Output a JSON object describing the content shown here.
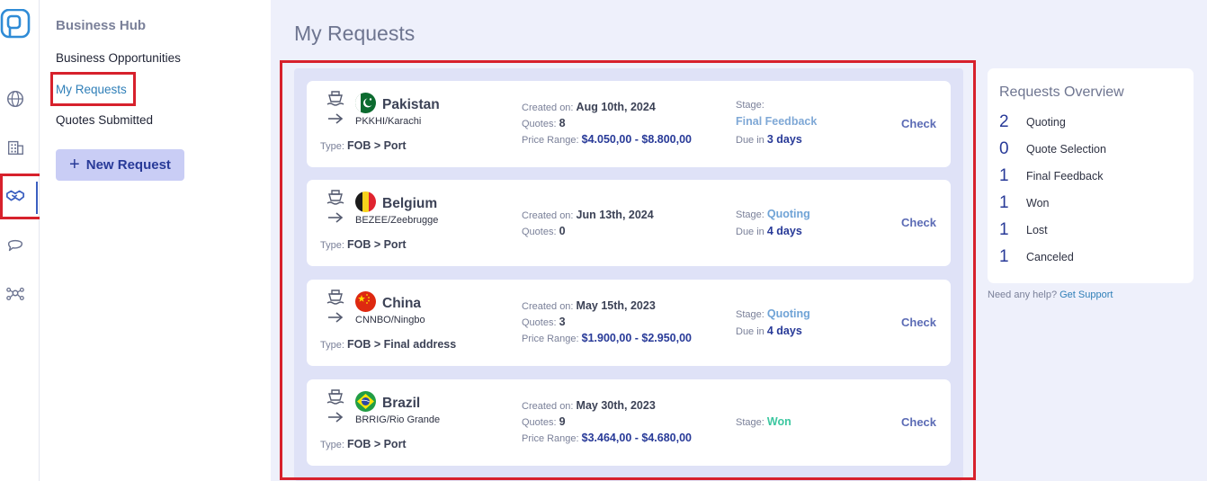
{
  "sidebar": {
    "hub_title": "Business Hub",
    "items": [
      {
        "label": "Business Opportunities"
      },
      {
        "label": "My Requests"
      },
      {
        "label": "Quotes Submitted"
      }
    ],
    "new_request_label": "New Request"
  },
  "rail": {
    "icons": [
      "logo-icon",
      "globe-icon",
      "building-icon",
      "handshake-icon",
      "chat-icon",
      "network-icon"
    ]
  },
  "main": {
    "title": "My Requests",
    "requests": [
      {
        "country": "Pakistan",
        "port": "PKKHI/Karachi",
        "type_label": "Type:",
        "type": "FOB > Port",
        "created_label": "Created on:",
        "created": "Aug 10th, 2024",
        "quotes_label": "Quotes:",
        "quotes": "8",
        "price_label": "Price Range:",
        "price": "$4.050,00 - $8.800,00",
        "stage_label": "Stage:",
        "stage": "Final Feedback",
        "due_label": "Due in",
        "due": "3 days",
        "action": "Check"
      },
      {
        "country": "Belgium",
        "port": "BEZEE/Zeebrugge",
        "type_label": "Type:",
        "type": "FOB > Port",
        "created_label": "Created on:",
        "created": "Jun 13th, 2024",
        "quotes_label": "Quotes:",
        "quotes": "0",
        "stage_label": "Stage:",
        "stage": "Quoting",
        "due_label": "Due in",
        "due": "4 days",
        "action": "Check"
      },
      {
        "country": "China",
        "port": "CNNBO/Ningbo",
        "type_label": "Type:",
        "type": "FOB > Final address",
        "created_label": "Created on:",
        "created": "May 15th, 2023",
        "quotes_label": "Quotes:",
        "quotes": "3",
        "price_label": "Price Range:",
        "price": "$1.900,00 - $2.950,00",
        "stage_label": "Stage:",
        "stage": "Quoting",
        "due_label": "Due in",
        "due": "4 days",
        "action": "Check"
      },
      {
        "country": "Brazil",
        "port": "BRRIG/Rio Grande",
        "type_label": "Type:",
        "type": "FOB > Port",
        "created_label": "Created on:",
        "created": "May 30th, 2023",
        "quotes_label": "Quotes:",
        "quotes": "9",
        "price_label": "Price Range:",
        "price": "$3.464,00 - $4.680,00",
        "stage_label": "Stage:",
        "stage": "Won",
        "action": "Check"
      }
    ]
  },
  "overview": {
    "title": "Requests Overview",
    "rows": [
      {
        "count": "2",
        "label": "Quoting"
      },
      {
        "count": "0",
        "label": "Quote Selection"
      },
      {
        "count": "1",
        "label": "Final Feedback"
      },
      {
        "count": "1",
        "label": "Won"
      },
      {
        "count": "1",
        "label": "Lost"
      },
      {
        "count": "1",
        "label": "Canceled"
      }
    ],
    "help_text": "Need any help?",
    "help_link": "Get Support"
  },
  "colors": {
    "accent": "#283a98",
    "stage_final_feedback": "#7fa8d6",
    "stage_quoting": "#6fa3d6",
    "stage_won": "#3cc7a0",
    "highlight": "#d7212c"
  }
}
